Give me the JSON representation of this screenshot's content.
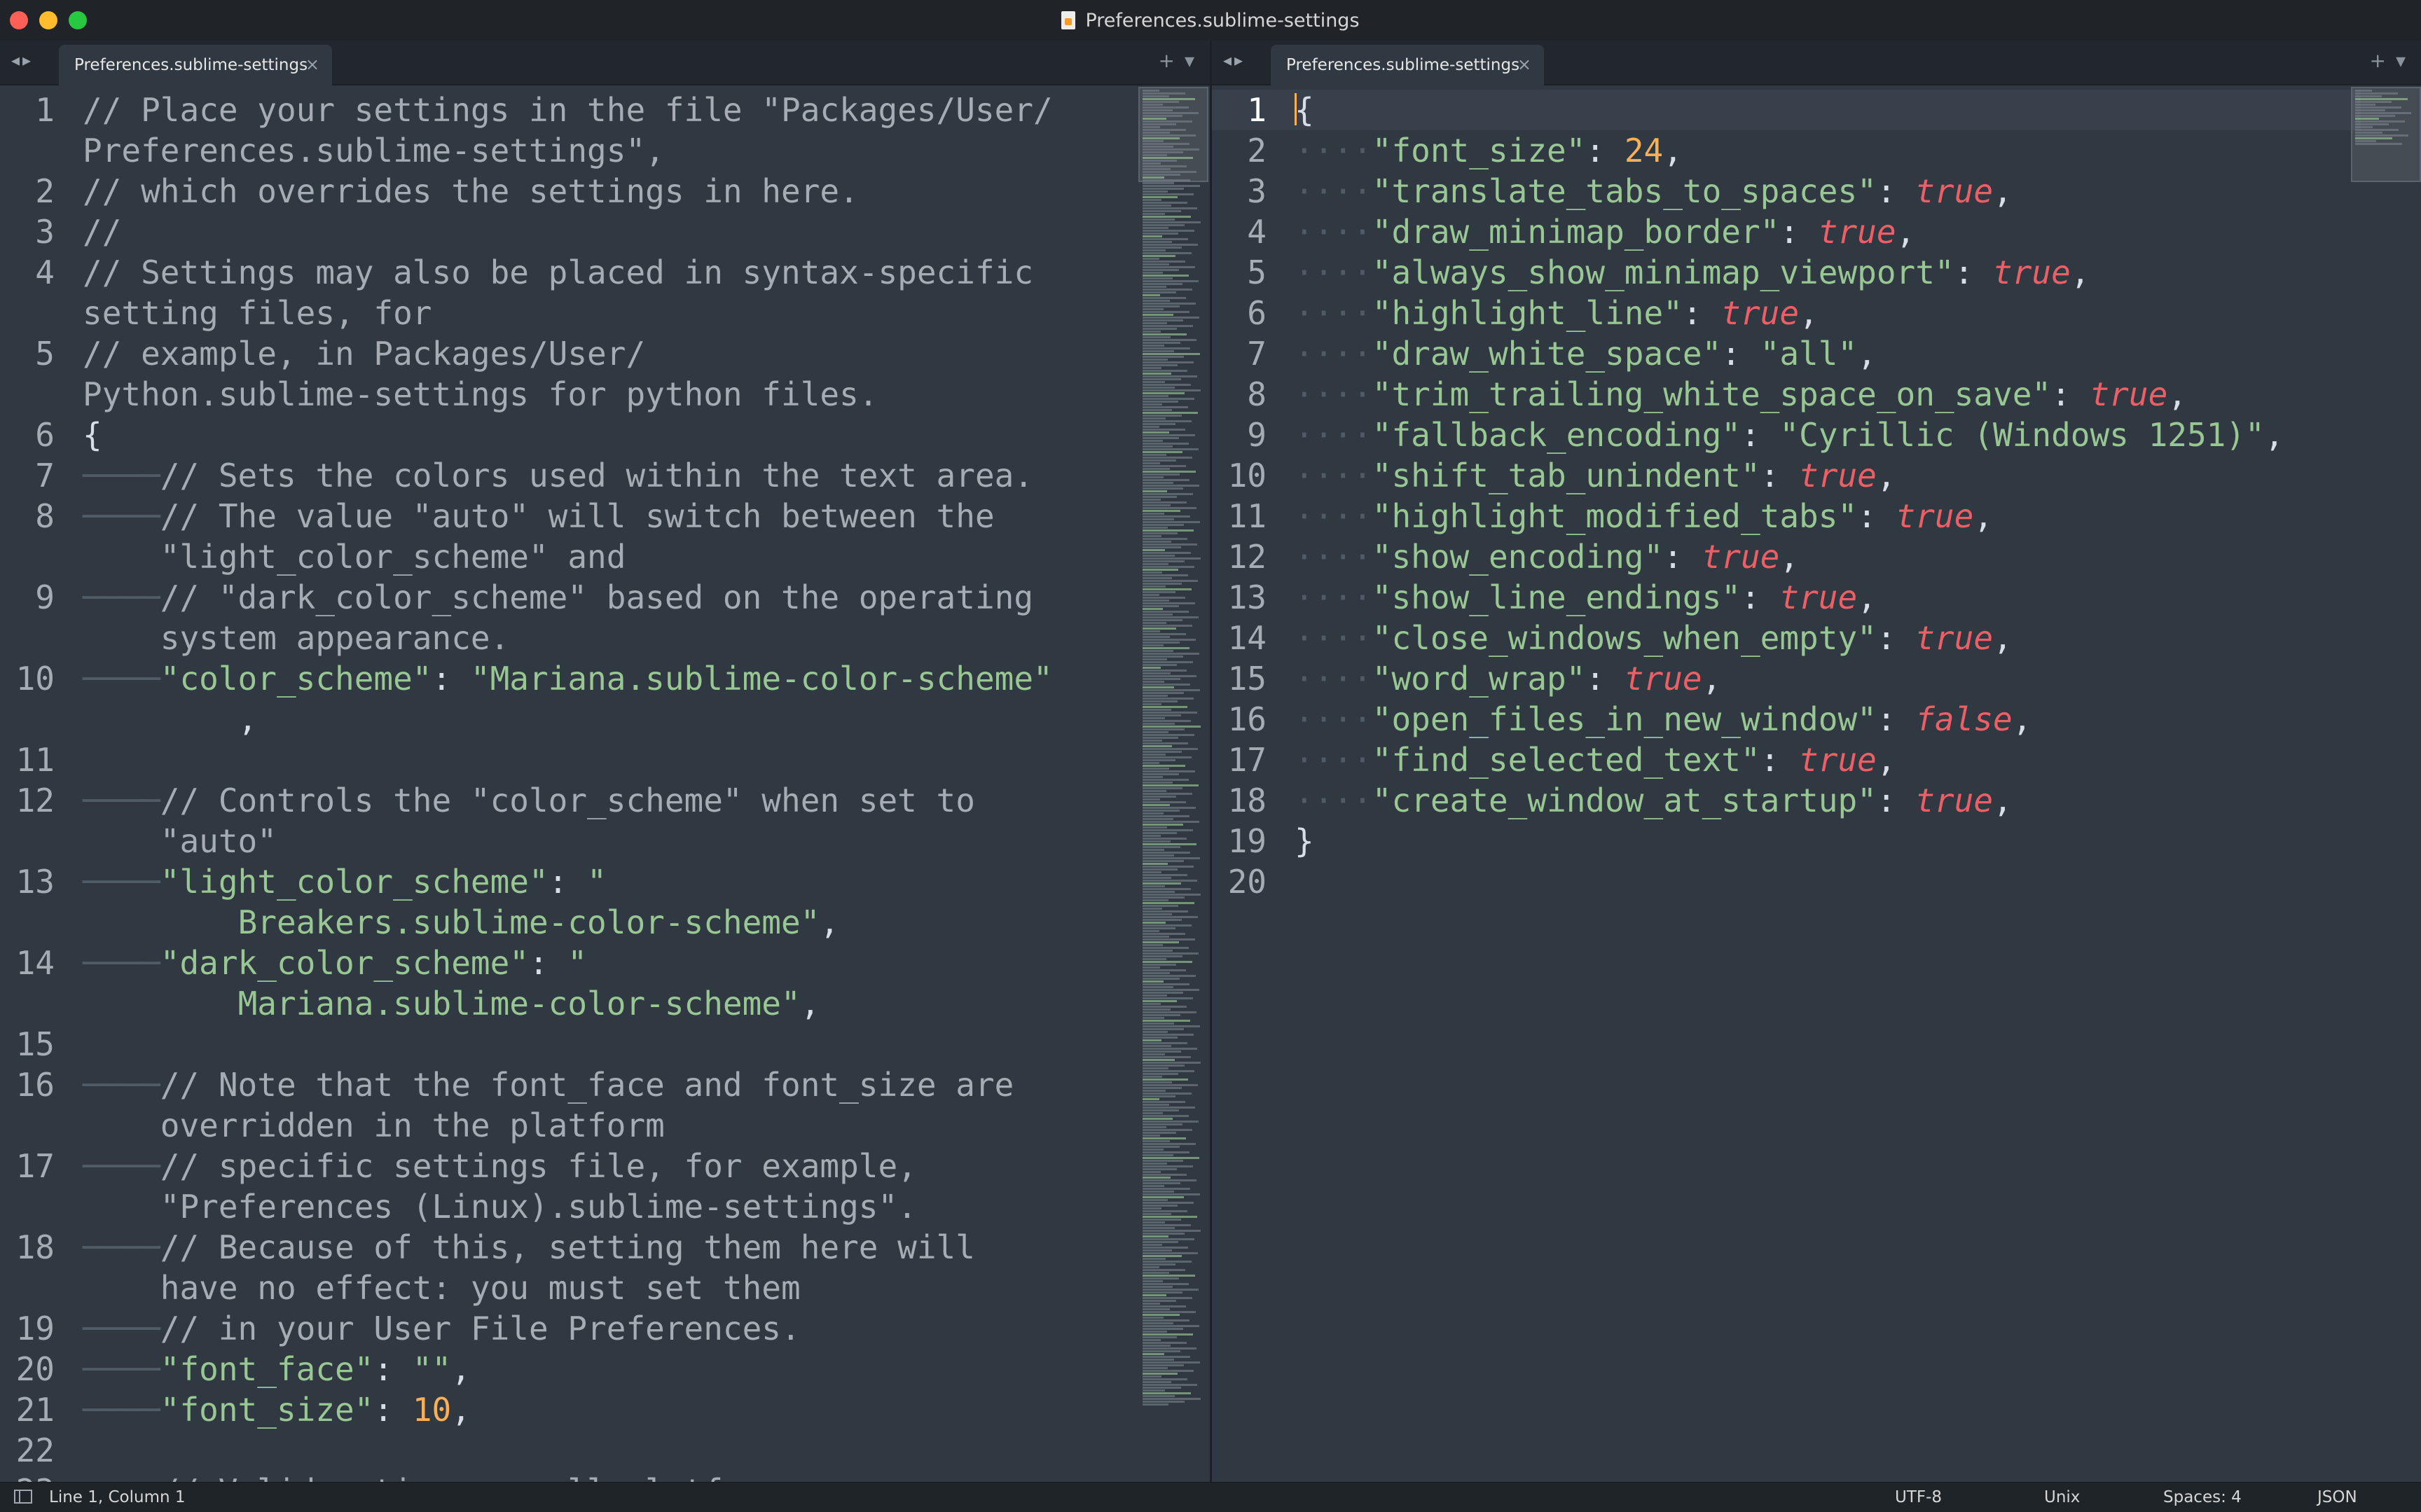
{
  "window": {
    "title": "Preferences.sublime-settings"
  },
  "left_tab": {
    "label": "Preferences.sublime-settings"
  },
  "right_tab": {
    "label": "Preferences.sublime-settings"
  },
  "icons": {
    "nav": "left-right-arrows-icon",
    "close": "close-icon",
    "new_tab": "plus-icon",
    "tab_menu": "chevron-down-icon",
    "file": "document-icon"
  },
  "status": {
    "position": "Line 1, Column 1",
    "encoding": "UTF-8",
    "line_endings": "Unix",
    "indentation": "Spaces: 4",
    "syntax": "JSON"
  },
  "left_code": [
    {
      "n": "1",
      "segs": [
        [
          "cm",
          "// Place your settings in the file \"Packages/User/"
        ]
      ]
    },
    {
      "n": "",
      "segs": [
        [
          "cm",
          "Preferences.sublime-settings\","
        ]
      ]
    },
    {
      "n": "2",
      "segs": [
        [
          "cm",
          "// which overrides the settings in here."
        ]
      ]
    },
    {
      "n": "3",
      "segs": [
        [
          "cm",
          "//"
        ]
      ]
    },
    {
      "n": "4",
      "segs": [
        [
          "cm",
          "// Settings may also be placed in syntax-specific"
        ]
      ]
    },
    {
      "n": "",
      "segs": [
        [
          "cm",
          "setting files, for"
        ]
      ]
    },
    {
      "n": "5",
      "segs": [
        [
          "cm",
          "// example, in Packages/User/"
        ]
      ]
    },
    {
      "n": "",
      "segs": [
        [
          "cm",
          "Python.sublime-settings for python files."
        ]
      ]
    },
    {
      "n": "6",
      "segs": [
        [
          "pu",
          "{"
        ]
      ]
    },
    {
      "n": "7",
      "indent": true,
      "segs": [
        [
          "cm",
          "// Sets the colors used within the text area."
        ]
      ]
    },
    {
      "n": "8",
      "indent": true,
      "segs": [
        [
          "cm",
          "// The value \"auto\" will switch between the"
        ]
      ]
    },
    {
      "n": "",
      "wrap": true,
      "segs": [
        [
          "cm",
          "\"light_color_scheme\" and"
        ]
      ]
    },
    {
      "n": "9",
      "indent": true,
      "segs": [
        [
          "cm",
          "// \"dark_color_scheme\" based on the operating"
        ]
      ]
    },
    {
      "n": "",
      "wrap": true,
      "segs": [
        [
          "cm",
          "system appearance."
        ]
      ]
    },
    {
      "n": "10",
      "indent": true,
      "segs": [
        [
          "st",
          "\"color_scheme\""
        ],
        [
          "pu",
          ": "
        ],
        [
          "st",
          "\"Mariana.sublime-color-scheme\""
        ]
      ]
    },
    {
      "n": "",
      "wrap2": true,
      "segs": [
        [
          "pu",
          ","
        ]
      ]
    },
    {
      "n": "11",
      "segs": []
    },
    {
      "n": "12",
      "indent": true,
      "segs": [
        [
          "cm",
          "// Controls the \"color_scheme\" when set to"
        ]
      ]
    },
    {
      "n": "",
      "wrap": true,
      "segs": [
        [
          "cm",
          "\"auto\""
        ]
      ]
    },
    {
      "n": "13",
      "indent": true,
      "segs": [
        [
          "st",
          "\"light_color_scheme\""
        ],
        [
          "pu",
          ": "
        ],
        [
          "st",
          "\""
        ]
      ]
    },
    {
      "n": "",
      "wrap2": true,
      "segs": [
        [
          "st",
          "Breakers.sublime-color-scheme\""
        ],
        [
          "pu",
          ","
        ]
      ]
    },
    {
      "n": "14",
      "indent": true,
      "segs": [
        [
          "st",
          "\"dark_color_scheme\""
        ],
        [
          "pu",
          ": "
        ],
        [
          "st",
          "\""
        ]
      ]
    },
    {
      "n": "",
      "wrap2": true,
      "segs": [
        [
          "st",
          "Mariana.sublime-color-scheme\""
        ],
        [
          "pu",
          ","
        ]
      ]
    },
    {
      "n": "15",
      "segs": []
    },
    {
      "n": "16",
      "indent": true,
      "segs": [
        [
          "cm",
          "// Note that the font_face and font_size are"
        ]
      ]
    },
    {
      "n": "",
      "wrap": true,
      "segs": [
        [
          "cm",
          "overridden in the platform"
        ]
      ]
    },
    {
      "n": "17",
      "indent": true,
      "segs": [
        [
          "cm",
          "// specific settings file, for example,"
        ]
      ]
    },
    {
      "n": "",
      "wrap": true,
      "segs": [
        [
          "cm",
          "\"Preferences (Linux).sublime-settings\"."
        ]
      ]
    },
    {
      "n": "18",
      "indent": true,
      "segs": [
        [
          "cm",
          "// Because of this, setting them here will"
        ]
      ]
    },
    {
      "n": "",
      "wrap": true,
      "segs": [
        [
          "cm",
          "have no effect: you must set them"
        ]
      ]
    },
    {
      "n": "19",
      "indent": true,
      "segs": [
        [
          "cm",
          "// in your User File Preferences."
        ]
      ]
    },
    {
      "n": "20",
      "indent": true,
      "segs": [
        [
          "st",
          "\"font_face\""
        ],
        [
          "pu",
          ": "
        ],
        [
          "st",
          "\"\""
        ],
        [
          "pu",
          ","
        ]
      ]
    },
    {
      "n": "21",
      "indent": true,
      "segs": [
        [
          "st",
          "\"font_size\""
        ],
        [
          "pu",
          ": "
        ],
        [
          "nu",
          "10"
        ],
        [
          "pu",
          ","
        ]
      ]
    },
    {
      "n": "22",
      "segs": []
    },
    {
      "n": "23",
      "indent": true,
      "segs": [
        [
          "cm",
          "// Valid options on all platforms are:"
        ]
      ]
    }
  ],
  "right_code": [
    {
      "n": "1",
      "segs": [
        [
          "pu",
          "{"
        ]
      ]
    },
    {
      "n": "2",
      "segs": [
        [
          "st",
          "\"font_size\""
        ],
        [
          "pu",
          ": "
        ],
        [
          "nu",
          "24"
        ],
        [
          "pu",
          ","
        ]
      ]
    },
    {
      "n": "3",
      "segs": [
        [
          "st",
          "\"translate_tabs_to_spaces\""
        ],
        [
          "pu",
          ": "
        ],
        [
          "kw",
          "true"
        ],
        [
          "pu",
          ","
        ]
      ]
    },
    {
      "n": "4",
      "segs": [
        [
          "st",
          "\"draw_minimap_border\""
        ],
        [
          "pu",
          ": "
        ],
        [
          "kw",
          "true"
        ],
        [
          "pu",
          ","
        ]
      ]
    },
    {
      "n": "5",
      "segs": [
        [
          "st",
          "\"always_show_minimap_viewport\""
        ],
        [
          "pu",
          ": "
        ],
        [
          "kw",
          "true"
        ],
        [
          "pu",
          ","
        ]
      ]
    },
    {
      "n": "6",
      "segs": [
        [
          "st",
          "\"highlight_line\""
        ],
        [
          "pu",
          ": "
        ],
        [
          "kw",
          "true"
        ],
        [
          "pu",
          ","
        ]
      ]
    },
    {
      "n": "7",
      "segs": [
        [
          "st",
          "\"draw_white_space\""
        ],
        [
          "pu",
          ": "
        ],
        [
          "st",
          "\"all\""
        ],
        [
          "pu",
          ","
        ]
      ]
    },
    {
      "n": "8",
      "segs": [
        [
          "st",
          "\"trim_trailing_white_space_on_save\""
        ],
        [
          "pu",
          ": "
        ],
        [
          "kw",
          "true"
        ],
        [
          "pu",
          ","
        ]
      ]
    },
    {
      "n": "9",
      "segs": [
        [
          "st",
          "\"fallback_encoding\""
        ],
        [
          "pu",
          ": "
        ],
        [
          "st",
          "\"Cyrillic (Windows 1251)\""
        ],
        [
          "pu",
          ","
        ]
      ]
    },
    {
      "n": "10",
      "segs": [
        [
          "st",
          "\"shift_tab_unindent\""
        ],
        [
          "pu",
          ": "
        ],
        [
          "kw",
          "true"
        ],
        [
          "pu",
          ","
        ]
      ]
    },
    {
      "n": "11",
      "segs": [
        [
          "st",
          "\"highlight_modified_tabs\""
        ],
        [
          "pu",
          ": "
        ],
        [
          "kw",
          "true"
        ],
        [
          "pu",
          ","
        ]
      ]
    },
    {
      "n": "12",
      "segs": [
        [
          "st",
          "\"show_encoding\""
        ],
        [
          "pu",
          ": "
        ],
        [
          "kw",
          "true"
        ],
        [
          "pu",
          ","
        ]
      ]
    },
    {
      "n": "13",
      "segs": [
        [
          "st",
          "\"show_line_endings\""
        ],
        [
          "pu",
          ": "
        ],
        [
          "kw",
          "true"
        ],
        [
          "pu",
          ","
        ]
      ]
    },
    {
      "n": "14",
      "segs": [
        [
          "st",
          "\"close_windows_when_empty\""
        ],
        [
          "pu",
          ": "
        ],
        [
          "kw",
          "true"
        ],
        [
          "pu",
          ","
        ]
      ]
    },
    {
      "n": "15",
      "segs": [
        [
          "st",
          "\"word_wrap\""
        ],
        [
          "pu",
          ": "
        ],
        [
          "kw",
          "true"
        ],
        [
          "pu",
          ","
        ]
      ]
    },
    {
      "n": "16",
      "segs": [
        [
          "st",
          "\"open_files_in_new_window\""
        ],
        [
          "pu",
          ": "
        ],
        [
          "kw",
          "false"
        ],
        [
          "pu",
          ","
        ]
      ]
    },
    {
      "n": "17",
      "segs": [
        [
          "st",
          "\"find_selected_text\""
        ],
        [
          "pu",
          ": "
        ],
        [
          "kw",
          "true"
        ],
        [
          "pu",
          ","
        ]
      ]
    },
    {
      "n": "18",
      "segs": [
        [
          "st",
          "\"create_window_at_startup\""
        ],
        [
          "pu",
          ": "
        ],
        [
          "kw",
          "true"
        ],
        [
          "pu",
          ","
        ]
      ]
    },
    {
      "n": "19",
      "segs": [
        [
          "pu",
          "}"
        ]
      ]
    },
    {
      "n": "20",
      "segs": []
    }
  ]
}
